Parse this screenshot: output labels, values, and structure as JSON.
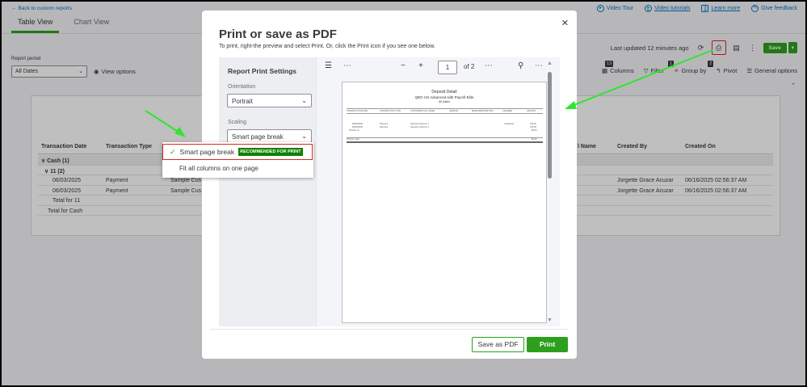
{
  "header": {
    "back_link": "Back to custom reports",
    "links": [
      {
        "label": "Video Tour",
        "icon": "play-icon"
      },
      {
        "label": "Video tutorials",
        "icon": "play-circle-icon"
      },
      {
        "label": "Learn more",
        "icon": "book-icon"
      },
      {
        "label": "Give feedback",
        "icon": "edit-icon"
      }
    ]
  },
  "tabs": [
    "Table View",
    "Chart View"
  ],
  "report_period": {
    "label": "Report period",
    "value": "All Dates"
  },
  "view_options": "View options",
  "last_updated": "Last updated 12 minutes ago",
  "save": {
    "label": "Save",
    "dropdown": "▾"
  },
  "toolbar": {
    "columns": {
      "label": "Columns",
      "badge": "13"
    },
    "filter": {
      "label": "Filter",
      "badge": "1"
    },
    "group_by": {
      "label": "Group by",
      "badge": "2"
    },
    "pivot": "Pivot",
    "general_options": "General options"
  },
  "table": {
    "headers": [
      "Transaction Date",
      "Transaction Type",
      "l Name",
      "Created By",
      "Created On"
    ],
    "rows": [
      {
        "c1": "∨  Cash (1)",
        "c2": "",
        "c3": "",
        "c4": "",
        "c5": "",
        "shade": true,
        "bold": true
      },
      {
        "c1": "∨  11 (2)",
        "c2": "",
        "c3": "",
        "c4": "",
        "c5": "",
        "shade": false,
        "bold": true
      },
      {
        "c1": "06/03/2025",
        "c2": "Payment",
        "c3": "Sample Cus",
        "c4": "Jorgette Grace Acuzar",
        "c5": "06/16/2025 02:56:37 AM",
        "shade": false,
        "bold": false
      },
      {
        "c1": "06/03/2025",
        "c2": "Payment",
        "c3": "Sample Cus",
        "c4": "Jorgette Grace Acuzar",
        "c5": "06/16/2025 02:56:37 AM",
        "shade": false,
        "bold": false
      },
      {
        "c1": "Total for 11",
        "c2": "",
        "c3": "",
        "c4": "",
        "c5": "",
        "shade": false,
        "bold": false
      },
      {
        "c1": "Total for Cash",
        "c2": "",
        "c3": "",
        "c4": "",
        "c5": "",
        "shade": false,
        "bold": false
      }
    ]
  },
  "modal": {
    "title": "Print or save as PDF",
    "subtitle": "To print, right-the preview and select Print. Or, click the Print icon if you see one below.",
    "settings": {
      "title": "Report Print Settings",
      "orientation_label": "Orientation",
      "orientation_value": "Portrait",
      "scaling_label": "Scaling",
      "scaling_value": "Smart page break"
    },
    "dropdown": {
      "option1": "Smart page break",
      "option1_badge": "RECOMMENDED FOR PRINT",
      "option2": "Fit all columns on one page"
    },
    "preview": {
      "page": "1",
      "of_pages": "of 2",
      "sheet_title": "Deposit Detail",
      "sheet_company": "QBO US Advanced with Payroll Elite",
      "sheet_period": "All Dates"
    },
    "buttons": {
      "save_pdf": "Save as PDF",
      "print": "Print"
    }
  },
  "colors": {
    "brand_green": "#2ca01c",
    "highlight_red": "#d52b1e",
    "annotation_arrow": "#2ee62e"
  }
}
